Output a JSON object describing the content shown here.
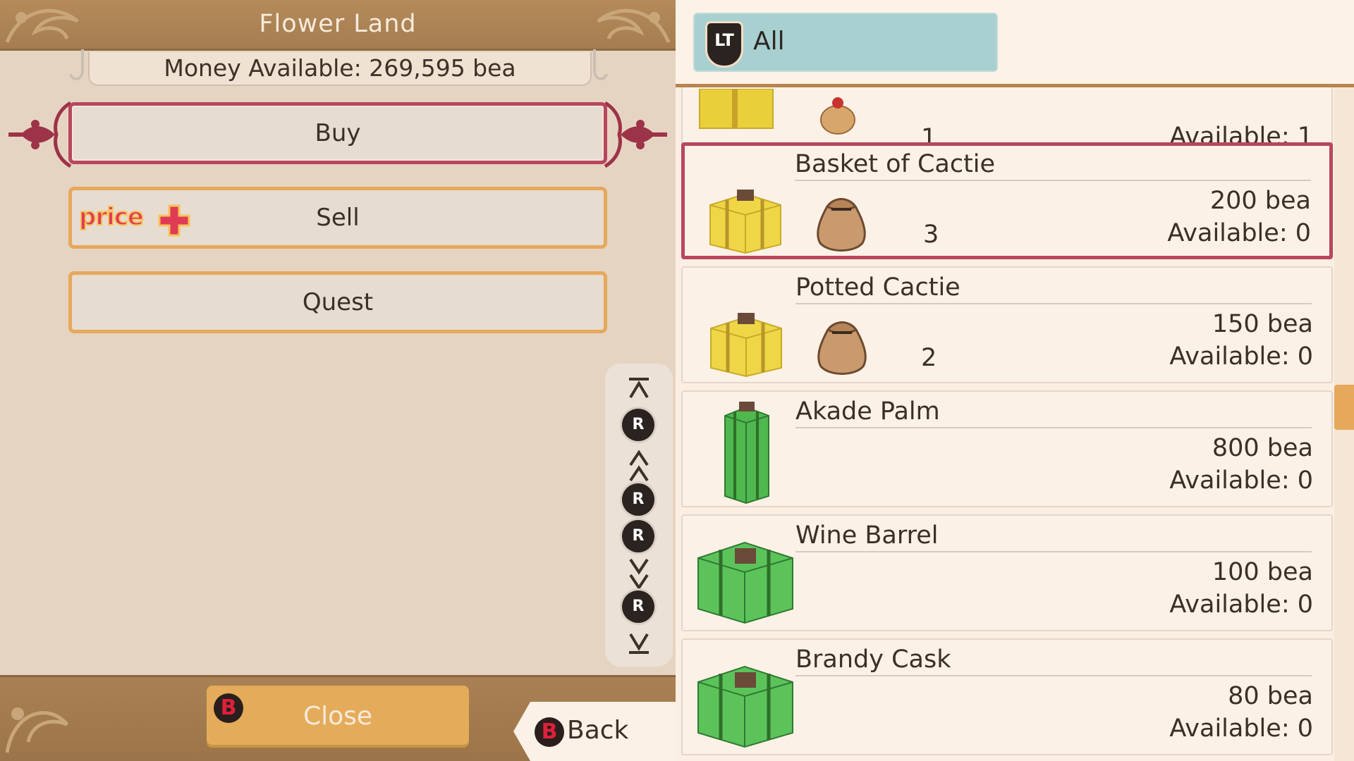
{
  "shop": {
    "title": "Flower Land",
    "money_label": "Money Available: 269,595 bea"
  },
  "menu": {
    "buy": "Buy",
    "sell": "Sell",
    "sell_badge": "price",
    "quest": "Quest"
  },
  "scroll_controls": {
    "r_label": "R"
  },
  "footer": {
    "close_badge": "B",
    "close_label": "Close",
    "back_badge": "B",
    "back_label": "Back"
  },
  "filter": {
    "trigger_label": "LT",
    "label": "All"
  },
  "items": [
    {
      "name": "",
      "quantity": "1",
      "price": "",
      "available": "Available: 1",
      "box_icon": "yellow-gift-box-icon",
      "bag_icon": "small-seed-bag-icon"
    },
    {
      "name": "Basket of Cactie",
      "quantity": "3",
      "price": "200 bea",
      "available": "Available: 0",
      "box_icon": "yellow-gift-box-icon",
      "bag_icon": "seed-bag-icon",
      "selected": true
    },
    {
      "name": "Potted Cactie",
      "quantity": "2",
      "price": "150 bea",
      "available": "Available: 0",
      "box_icon": "yellow-gift-box-icon",
      "bag_icon": "seed-bag-icon"
    },
    {
      "name": "Akade Palm",
      "quantity": "",
      "price": "800 bea",
      "available": "Available: 0",
      "box_icon": "tall-green-gift-box-icon"
    },
    {
      "name": "Wine Barrel",
      "quantity": "",
      "price": "100 bea",
      "available": "Available: 0",
      "box_icon": "green-gift-box-icon"
    },
    {
      "name": "Brandy Cask",
      "quantity": "",
      "price": "80 bea",
      "available": "Available: 0",
      "box_icon": "green-gift-box-icon"
    }
  ],
  "colors": {
    "selected_border": "#b8465d",
    "button_border": "#e6a85b",
    "filter_tab": "#a8d0d0",
    "header_brown": "#a47c50"
  }
}
